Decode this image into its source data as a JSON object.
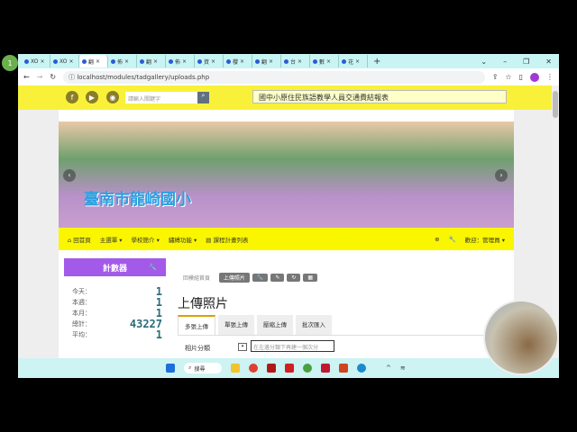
{
  "overlay_badge": "1",
  "browser": {
    "tabs": [
      {
        "label": "XO"
      },
      {
        "label": "XO"
      },
      {
        "label": "翻"
      },
      {
        "label": "佈"
      },
      {
        "label": "翻"
      },
      {
        "label": "佈"
      },
      {
        "label": "資"
      },
      {
        "label": "櫻"
      },
      {
        "label": "翻"
      },
      {
        "label": "台"
      },
      {
        "label": "數"
      },
      {
        "label": "花"
      }
    ],
    "new_tab": "+",
    "url": "localhost/modules/tadgallery/uploads.php"
  },
  "header": {
    "search_placeholder": "請輸入關鍵字",
    "marquee": "國中小原住民族語教學人員交通費結報表"
  },
  "banner": {
    "title": "臺南市龍崎國小"
  },
  "nav": {
    "items": [
      "回首頁",
      "主選單 ▾",
      "學校簡介 ▾",
      "繡縛功能 ▾",
      "課程計畫列表"
    ],
    "welcome": "歡迎：管理員 ▾"
  },
  "counter": {
    "title": "計數器",
    "rows": [
      {
        "label": "今天：",
        "value": "1"
      },
      {
        "label": "本週：",
        "value": "1"
      },
      {
        "label": "本月：",
        "value": "1"
      },
      {
        "label": "總計：",
        "value": "43227"
      },
      {
        "label": "平均：",
        "value": "1"
      }
    ]
  },
  "main": {
    "breadcrumb": "回模組首頁",
    "crumb_button": "上傳照片",
    "title": "上傳照片",
    "tabs": [
      "多張上傳",
      "單張上傳",
      "壓縮上傳",
      "批次匯入"
    ],
    "field_label": "相片分類",
    "field_placeholder": "在左邊分類下再建一個次分"
  },
  "taskbar": {
    "search": "搜尋"
  }
}
